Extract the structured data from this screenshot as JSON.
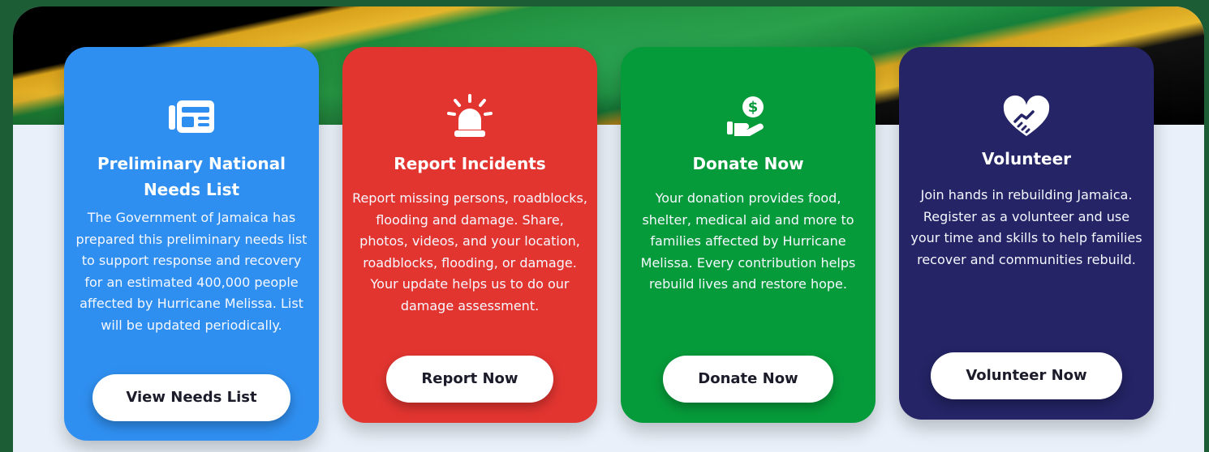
{
  "cards": [
    {
      "title": "Preliminary National Needs List",
      "icon": "newspaper-icon",
      "body": "The Government of Jamaica has prepared this preliminary needs list to support response and recovery for an estimated 400,000 people affected by Hurricane Melissa. List will be updated periodically.",
      "button": "View Needs List",
      "color": "#2f8ff0"
    },
    {
      "title": "Report Incidents",
      "icon": "siren-icon",
      "body": "Report missing persons, roadblocks, flooding and damage. Share, photos, videos, and your location, roadblocks, flooding, or damage. Your update helps us to do our damage assessment.",
      "button": "Report Now",
      "color": "#e33530"
    },
    {
      "title": "Donate Now",
      "icon": "hand-dollar-icon",
      "body": "Your donation provides food, shelter, medical aid and more to families affected by Hurricane Melissa. Every contribution helps rebuild lives and restore hope.",
      "button": "Donate Now",
      "color": "#069b3a"
    },
    {
      "title": "Volunteer",
      "icon": "heart-handshake-icon",
      "body": "Join hands in rebuilding Jamaica. Register as a volunteer and use your time and skills to help families recover and communities rebuild.",
      "button": "Volunteer Now",
      "color": "#242466"
    }
  ]
}
